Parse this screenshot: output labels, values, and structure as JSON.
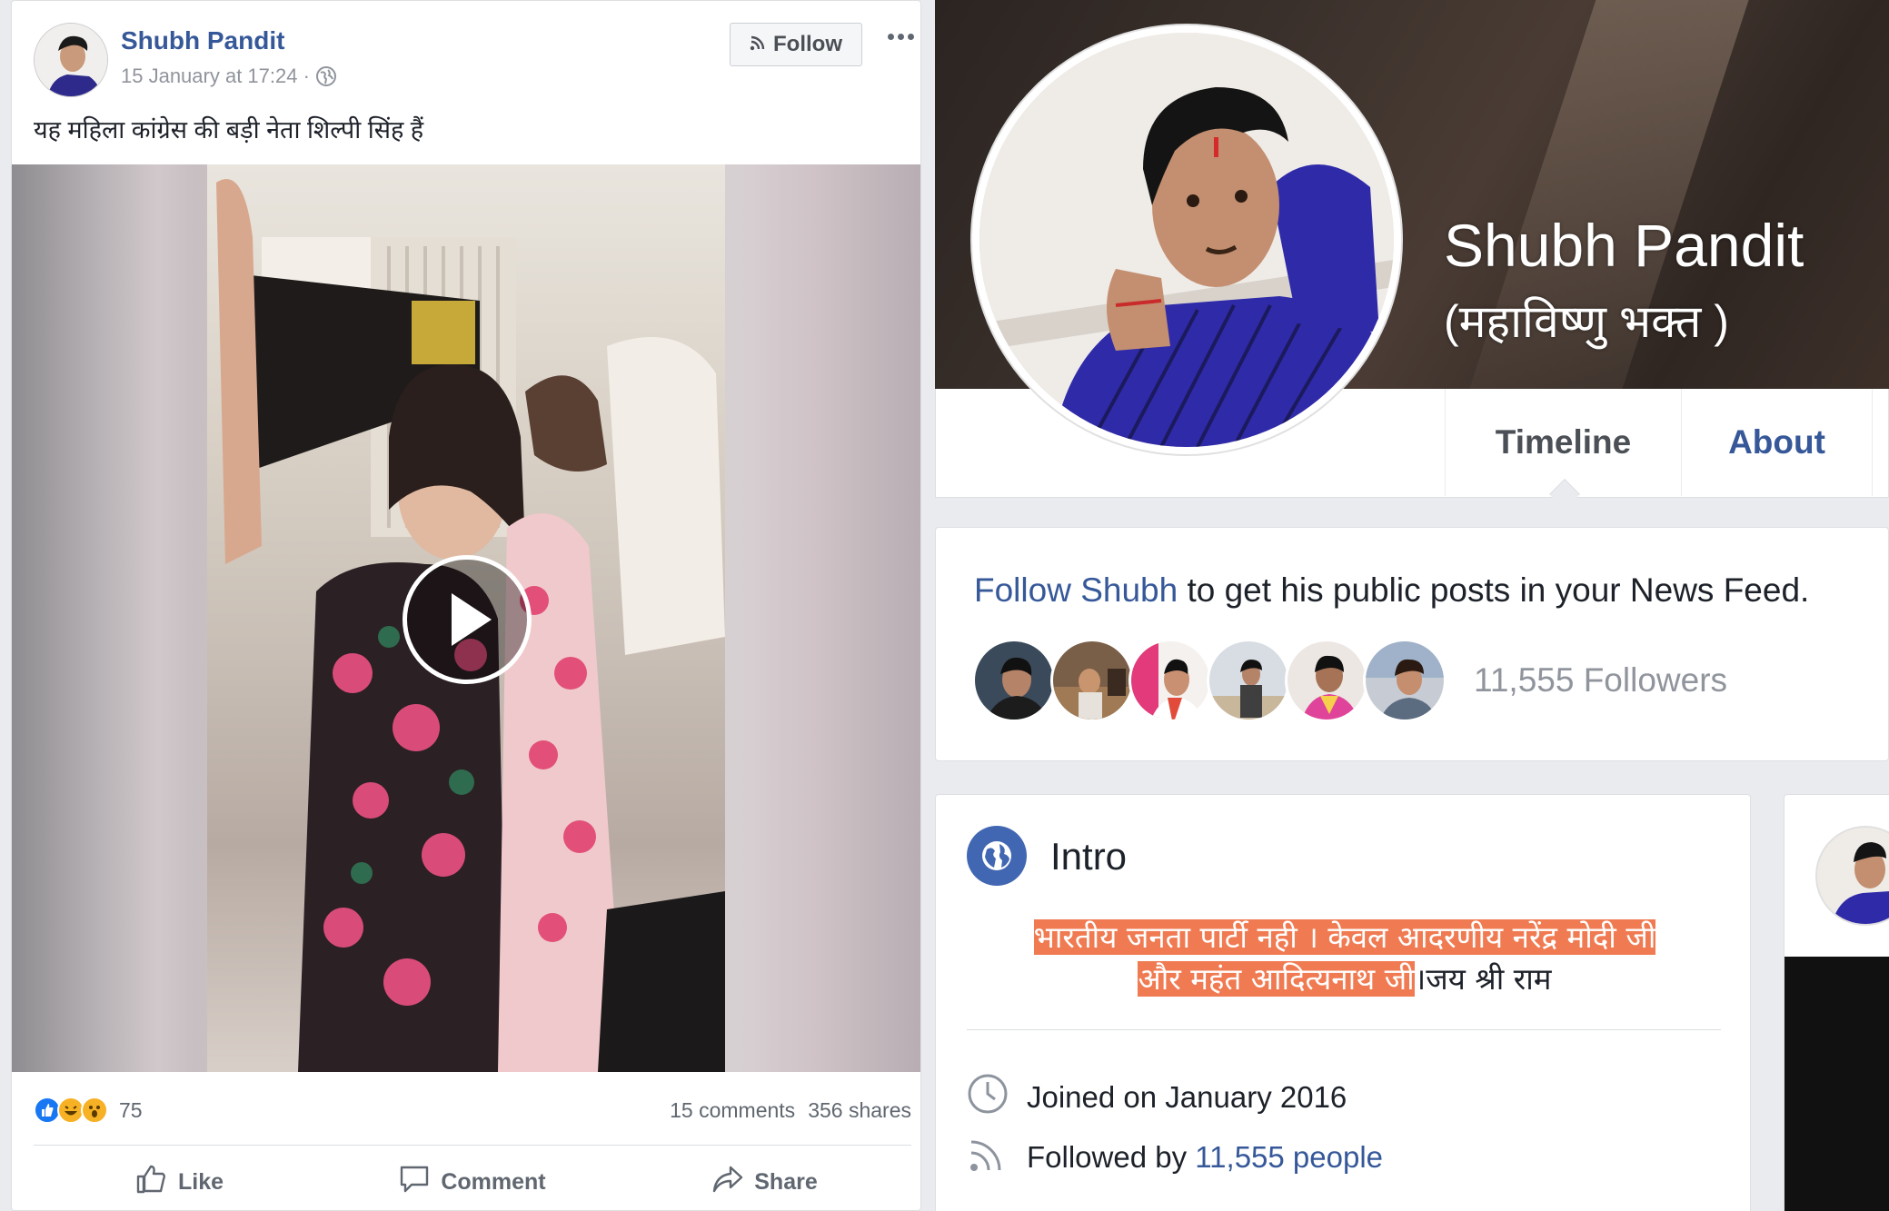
{
  "post": {
    "author": "Shubh Pandit",
    "timestamp": "15 January at 17:24 ·",
    "follow_label": "Follow",
    "text": "यह महिला कांग्रेस की बड़ी नेता शिल्पी सिंह हैं",
    "reaction_count": "75",
    "comments": "15 comments",
    "shares": "356 shares",
    "actions": {
      "like": "Like",
      "comment": "Comment",
      "share": "Share"
    }
  },
  "profile": {
    "name": "Shubh Pandit",
    "alternate_name": "(महाविष्णु भक्त )",
    "tabs": {
      "timeline": "Timeline",
      "about": "About"
    },
    "follow_prompt": {
      "link": "Follow Shubh",
      "rest": " to get his public posts in your News Feed."
    },
    "followers_count": "11,555 Followers",
    "intro": {
      "title": "Intro",
      "bio_highlight_1": "भारतीय जनता पार्टी नही । केवल आदरणीय नरेंद्र मोदी जी",
      "bio_highlight_2": "और महंत आदित्यनाथ जी",
      "bio_rest": "।जय श्री राम",
      "joined": "Joined on January 2016",
      "followed_by_prefix": "Followed by ",
      "followed_by_link": "11,555 people"
    }
  },
  "colors": {
    "link": "#365899",
    "highlight": "#f07b52",
    "like_blue": "#1877f2",
    "reaction_yellow": "#f7b125"
  }
}
